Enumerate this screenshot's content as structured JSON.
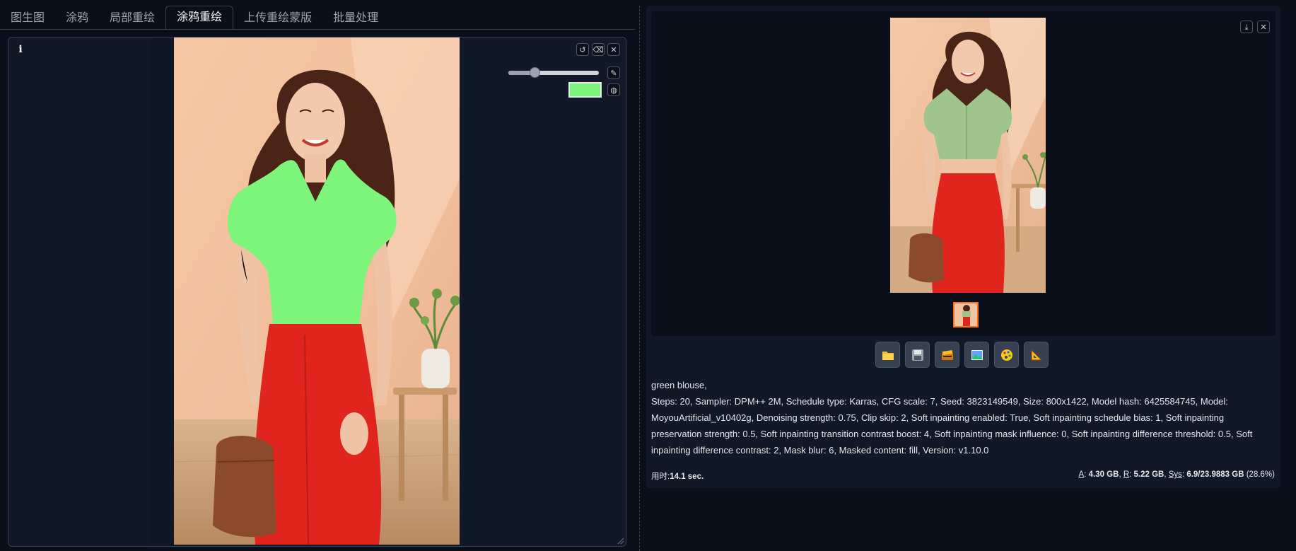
{
  "tabs": [
    {
      "label": "图生图"
    },
    {
      "label": "涂鸦"
    },
    {
      "label": "局部重绘"
    },
    {
      "label": "涂鸦重绘"
    },
    {
      "label": "上传重绘蒙版"
    },
    {
      "label": "批量处理"
    }
  ],
  "active_tab": "涂鸦重绘",
  "editor": {
    "info_label": "i",
    "brush_size_fraction": 0.29,
    "brush_color": "#7df57a"
  },
  "output": {
    "prompt_line": "green blouse,",
    "params": "Steps: 20, Sampler: DPM++ 2M, Schedule type: Karras, CFG scale: 7, Seed: 3823149549, Size: 800x1422, Model hash: 6425584745, Model: MoyouArtificial_v10402g, Denoising strength: 0.75, Clip skip: 2, Soft inpainting enabled: True, Soft inpainting schedule bias: 1, Soft inpainting preservation strength: 0.5, Soft inpainting transition contrast boost: 4, Soft inpainting mask influence: 0, Soft inpainting difference threshold: 0.5, Soft inpainting difference contrast: 2, Mask blur: 6, Masked content: fill, Version: v1.10.0",
    "time_label": "用时:",
    "time_value": "14.1 sec.",
    "mem": {
      "a_label": "A",
      "a_value": "4.30 GB",
      "r_label": "R",
      "r_value": "5.22 GB",
      "sys_label": "Sys",
      "sys_value": "6.9/23.9883 GB",
      "sys_percent": "(28.6%)"
    }
  },
  "colors": {
    "background": "#0b0f19",
    "panel": "#111827",
    "border": "#374151",
    "mask_green": "#7df57a",
    "thumb_selected": "#f97316"
  },
  "icons": {
    "editor_tools": [
      "undo-icon",
      "eraser-clear-icon",
      "close-icon"
    ],
    "brush": "brush-icon",
    "palette": "palette-icon",
    "gallery_tools": [
      "download-icon",
      "close-icon"
    ],
    "actions": [
      "folder-icon",
      "save-icon",
      "zip-icon",
      "send-to-img2img-icon",
      "send-to-inpaint-icon",
      "send-to-extras-icon"
    ]
  }
}
